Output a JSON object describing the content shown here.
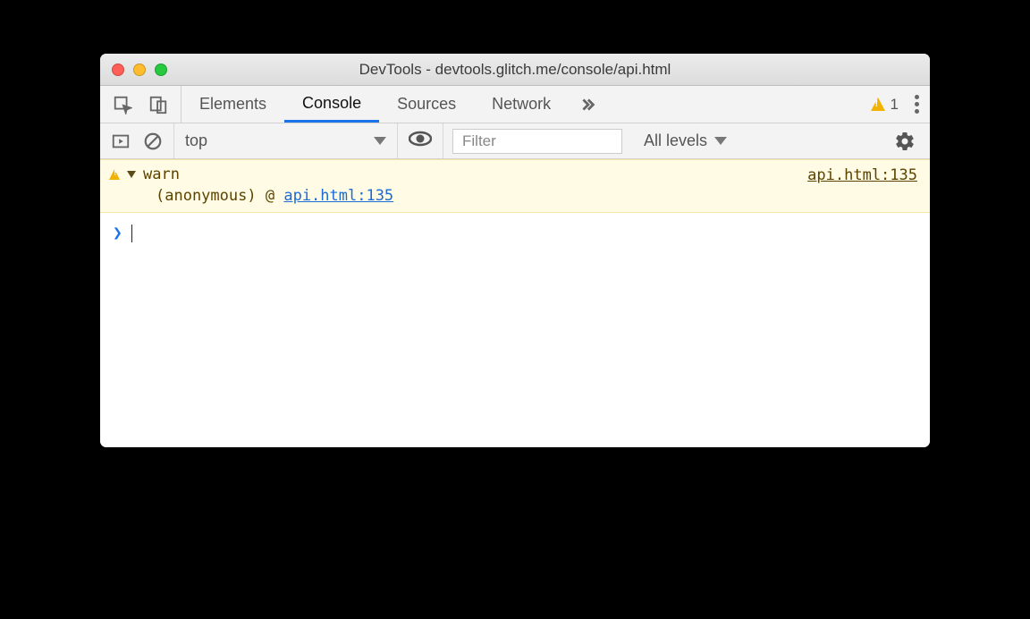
{
  "window": {
    "title": "DevTools - devtools.glitch.me/console/api.html"
  },
  "tabstrip": {
    "tabs": [
      "Elements",
      "Console",
      "Sources",
      "Network"
    ],
    "active_index": 1,
    "warning_count": "1"
  },
  "toolbar": {
    "context": "top",
    "filter_placeholder": "Filter",
    "levels_label": "All levels"
  },
  "console": {
    "warn_label": "warn",
    "source_link": "api.html:135",
    "stack_anon": "(anonymous)",
    "stack_at": "@",
    "stack_link": "api.html:135"
  }
}
